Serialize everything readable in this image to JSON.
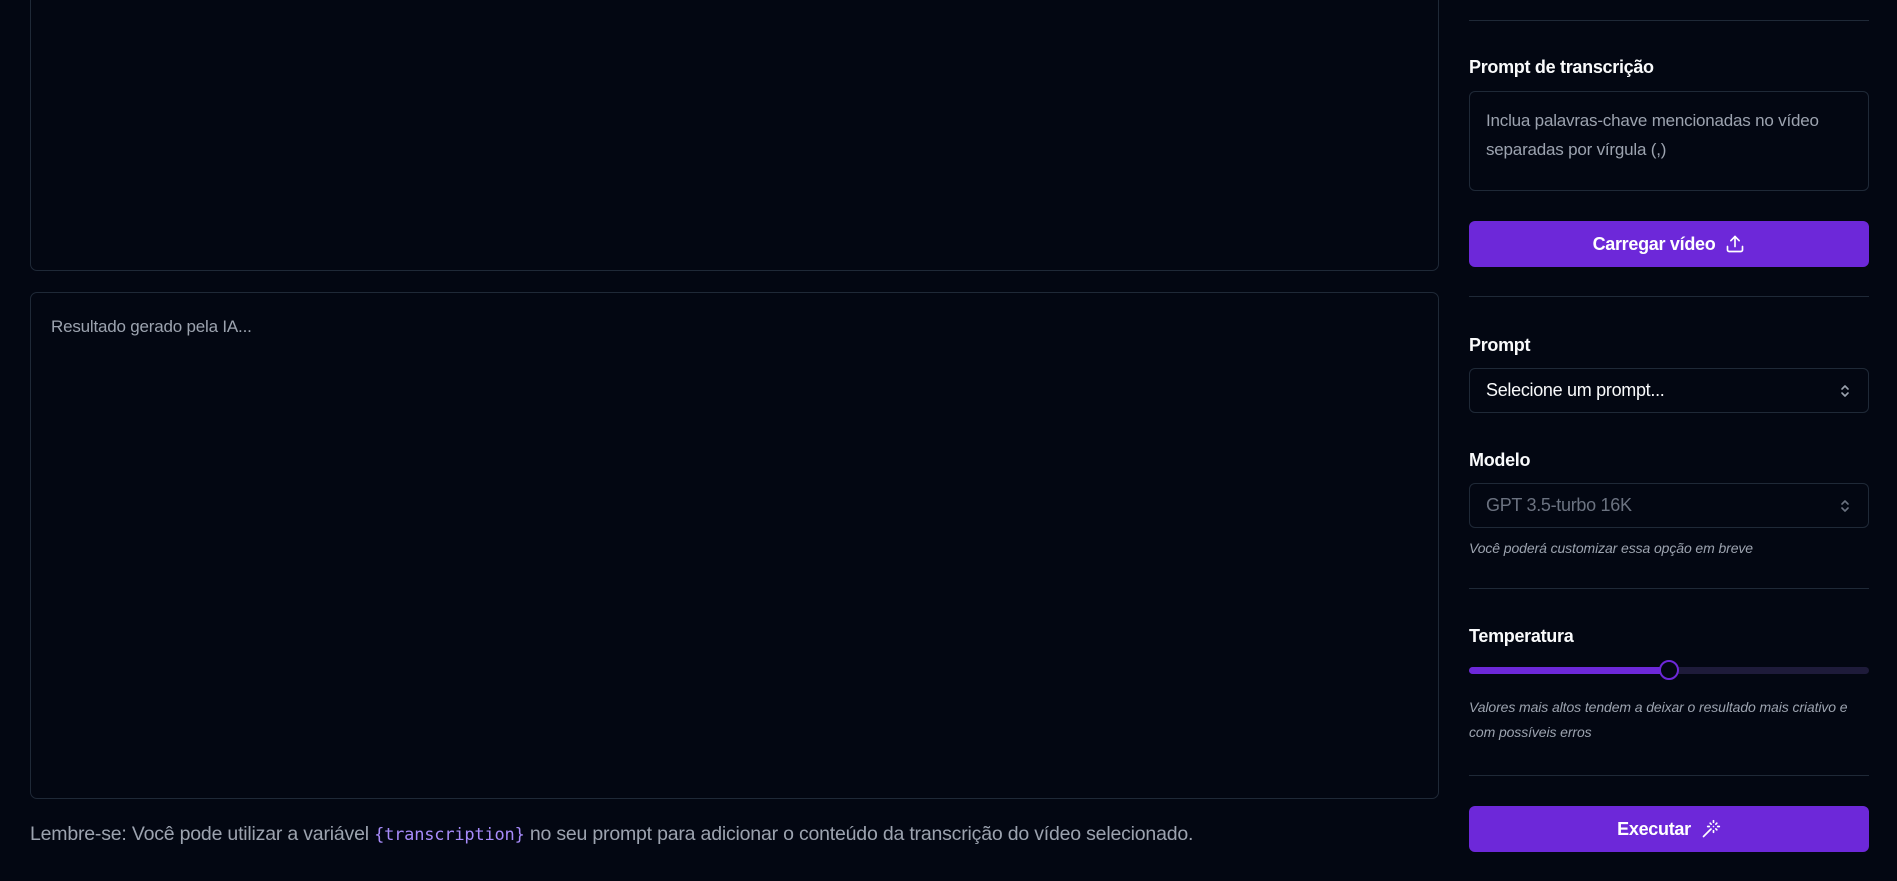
{
  "left": {
    "result_placeholder": "Resultado gerado pela IA...",
    "reminder_prefix": "Lembre-se: Você pode utilizar a variável ",
    "reminder_var": "{transcription}",
    "reminder_suffix": " no seu prompt para adicionar o conteúdo da transcrição do vídeo selecionado."
  },
  "sidebar": {
    "transcription_label": "Prompt de transcrição",
    "transcription_placeholder": "Inclua palavras-chave mencionadas no vídeo separadas por vírgula (,)",
    "upload_button": "Carregar vídeo",
    "prompt_label": "Prompt",
    "prompt_select": "Selecione um prompt...",
    "model_label": "Modelo",
    "model_select": "GPT 3.5-turbo 16K",
    "model_hint": "Você poderá customizar essa opção em breve",
    "temperature_label": "Temperatura",
    "temperature_value": 0.5,
    "temperature_hint": "Valores mais altos tendem a deixar o resultado mais criativo e com possíveis erros",
    "execute_button": "Executar"
  },
  "icons": {
    "upload": "upload-icon",
    "wand": "magic-wand-icon",
    "chevrons": "chevrons-up-down-icon"
  },
  "colors": {
    "background": "#030712",
    "accent": "#6d28d9",
    "border": "#1f2937",
    "muted_text": "#9ca3af",
    "code_text": "#a78bfa"
  }
}
